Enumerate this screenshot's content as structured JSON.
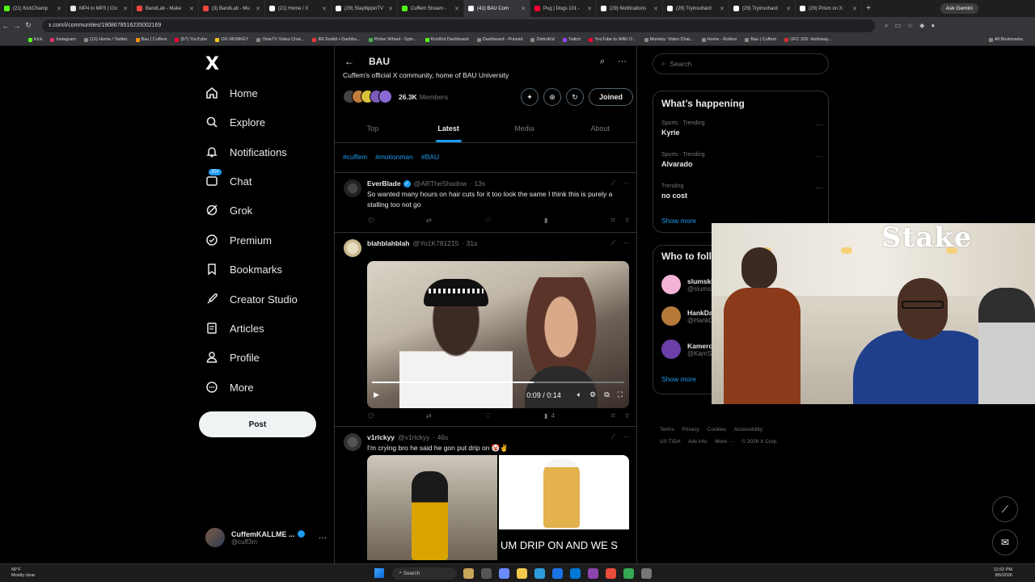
{
  "browser": {
    "tabs": [
      {
        "label": "(21) KickChamp",
        "color": "#53fc18"
      },
      {
        "label": "MP4 to MP3 | Clo",
        "color": "#e8e8e8"
      },
      {
        "label": "BandLab - Make",
        "color": "#f2493f"
      },
      {
        "label": "(3) BandLab - Mu",
        "color": "#f2493f"
      },
      {
        "label": "(21) Home / X",
        "color": "#ffffff"
      },
      {
        "label": "(29) StayttippinTV",
        "color": "#ffffff"
      },
      {
        "label": "Cuffem Stream - ",
        "color": "#53fc18"
      },
      {
        "label": "(41) BAU Com",
        "color": "#ffffff",
        "active": true
      },
      {
        "label": "Pug | Dogs 101 -",
        "color": "#ff0033"
      },
      {
        "label": "(29) Notifications",
        "color": "#ffffff"
      },
      {
        "label": "(29) Tryinsohard",
        "color": "#ffffff"
      },
      {
        "label": "(29) Tryinsohard",
        "color": "#ffffff"
      },
      {
        "label": "(29) Prism on X:",
        "color": "#ffffff"
      }
    ],
    "ask_gemini": "Ask Gemini",
    "url": "x.com/i/communities/1908678516235002169",
    "bookmarks": [
      "Kick",
      "Instagram",
      "(12) Home / Twitter",
      "Bau | Cuffem",
      "(57) YouTube",
      "OG MONKEY",
      "OmeTV Video Chat...",
      "IRLToolkit • Dashbo...",
      "Picker Wheel - Spin...",
      "KickBot Dashboard",
      "Dashboard - Pulsoid",
      "DistroKid",
      "Twitch",
      "YouTube to WAV D...",
      "Monkey: Video Chat...",
      "Home - Roblox",
      "Bau | Cuffem",
      "UFC 326: Holloway..."
    ],
    "all_bookmarks": "All Bookmarks"
  },
  "nav": {
    "logo": "X",
    "items": [
      {
        "label": "Home"
      },
      {
        "label": "Explore"
      },
      {
        "label": "Notifications"
      },
      {
        "label": "Chat",
        "badge": "20+"
      },
      {
        "label": "Grok"
      },
      {
        "label": "Premium"
      },
      {
        "label": "Bookmarks"
      },
      {
        "label": "Creator Studio"
      },
      {
        "label": "Articles"
      },
      {
        "label": "Profile"
      },
      {
        "label": "More"
      }
    ],
    "post_label": "Post",
    "account": {
      "name": "CuffemKALLME ...",
      "handle": "@cuff3m"
    }
  },
  "community": {
    "name": "BAU",
    "description": "Cuffem's official X community, home of BAU University",
    "members_count": "26.3K",
    "members_label": "Members",
    "joined_label": "Joined",
    "tabs": [
      "Top",
      "Latest",
      "Media",
      "About"
    ],
    "active_tab": "Latest",
    "hashtags": [
      "#cuffem",
      "#motionman",
      "#BAU"
    ]
  },
  "posts": [
    {
      "name": "EverBlade",
      "verified": true,
      "handle": "@ARTheShadow",
      "time": "· 13s",
      "text": "So wanted many hours on hair cuts for it too look the same I think this is purely a stalling too not go",
      "views": ""
    },
    {
      "name": "blahblahblah",
      "verified": false,
      "handle": "@Yo1K781215",
      "time": "· 31s",
      "text": "",
      "video_time": "0:09 / 0:14",
      "video_progress": 0.64,
      "views": "4"
    },
    {
      "name": "v1rlckyy",
      "verified": false,
      "handle": "@v1rlckyy",
      "time": "· 46s",
      "text": "I'm crying bro he said he gon put drip on 🤡✌",
      "media_caption": "UM DRIP ON AND WE S"
    }
  ],
  "sidebar": {
    "search_placeholder": "Search",
    "happening_title": "What’s happening",
    "trends": [
      {
        "context": "Sports · Trending",
        "topic": "Kyrie"
      },
      {
        "context": "Sports · Trending",
        "topic": "Alvarado"
      },
      {
        "context": "Trending",
        "topic": "no cost"
      }
    ],
    "show_more": "Show more",
    "follow_title": "Who to follow",
    "follow": [
      {
        "name": "slumskI",
        "handle": "@slumsI"
      },
      {
        "name": "HankDa",
        "handle": "@HankD"
      },
      {
        "name": "Kameron",
        "handle": "@KamS"
      }
    ],
    "footer": [
      "Terms",
      "Privacy",
      "Cookies",
      "Accessibility",
      "US TIDA",
      "Ads info",
      "More ···",
      "© 2026 X Corp."
    ]
  },
  "webcam": {
    "sign": "Stake"
  },
  "taskbar": {
    "weather_temp": "66°F",
    "weather_desc": "Mostly clear",
    "search": "Search",
    "time": "11:52 PM",
    "date": "8/5/2026"
  },
  "colors": {
    "accent": "#1d9bf0",
    "background": "#000000",
    "border": "#2f3336"
  }
}
